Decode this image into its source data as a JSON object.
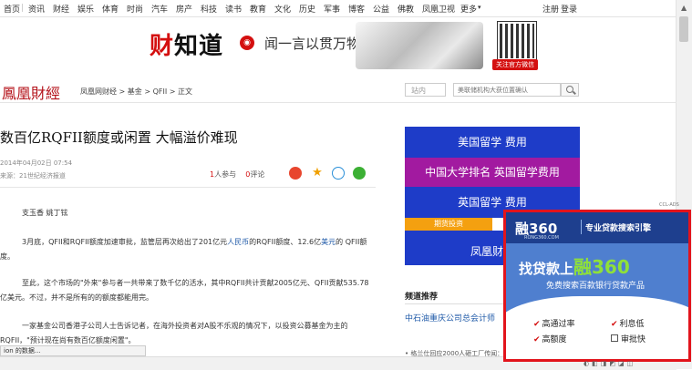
{
  "topnav": {
    "items": [
      "首页",
      "资讯",
      "财经",
      "娱乐",
      "体育",
      "时尚",
      "汽车",
      "房产",
      "科技",
      "读书",
      "教育",
      "文化",
      "历史",
      "军事",
      "博客",
      "公益",
      "佛教",
      "凤凰卫视",
      "更多"
    ],
    "login": "注册",
    "signin": "登录"
  },
  "banner": {
    "logo_a": "财",
    "logo_b": "知道",
    "slogan": "闻一言以贯万物",
    "follow": "关注官方微信"
  },
  "subbar": {
    "site_logo": "鳳凰財經",
    "breadcrumb": "凤凰网财经 > 基金 > QFII > 正文",
    "search_scope": "站内",
    "search_placeholder": "美联储机构大获位置确认"
  },
  "article": {
    "title": "数百亿RQFII额度或闲置 大幅溢价难现",
    "date": "2014年04月02日 07:54",
    "source": "来源：21世纪经济报道",
    "participants_count": "1",
    "participants_label": "人参与",
    "comments_count": "0",
    "comments_label": "评论",
    "authors": "支玉香 姚丁铉",
    "p1_a": "3月底，QFII和RQFII额度加速审批，监管层再次给出了201亿元",
    "p1_link1": "人民币",
    "p1_b": "的RQFII额度、12.6亿",
    "p1_link2": "美元",
    "p1_c": "的 QFII额度。",
    "p2": "至此，这个市场的\"外来\"参与者一共带来了数千亿的活水，其中RQFII共计贡献2005亿元、QFII贡献535.78亿美元。不过，并不是所有的的额度都能用完。",
    "p3": "一家基金公司香港子公司人士告诉记者，在海外投资者对A股不乐观的情况下，以投资公募基金为主的RQFII，\"预计现在尚有数百亿额度闲置\"。"
  },
  "ads": {
    "row1": "美国留学 费用",
    "row2a": "中国大学排名",
    "row2b": "英国留学费用",
    "row3": "英国留学 费用",
    "pill": "期货投资",
    "row4": "凤凰财经"
  },
  "recommend": {
    "heading": "频道推荐",
    "item": "中石油重庆公司总会计师",
    "ticker": "• 格兰仕回应2000人砸工厂传闻：..."
  },
  "status_bar": "ion 的数据...",
  "popup": {
    "corner_tag": "CCL-ADS",
    "brand": "融360",
    "brand_sub": "RONG360.COM",
    "tagline": "专业贷款搜索引擎",
    "headline_a": "找贷款上",
    "headline_b": "融360",
    "sub": "免费搜索百款银行贷款产品",
    "features": [
      "高通过率",
      "利息低",
      "高额度",
      "审批快"
    ],
    "colors": {
      "border": "#e2141c",
      "accent": "#8fe03a"
    }
  },
  "icons": [
    "weibo-icon",
    "star-icon",
    "comment-bubble-icon",
    "wechat-icon",
    "search-icon"
  ]
}
